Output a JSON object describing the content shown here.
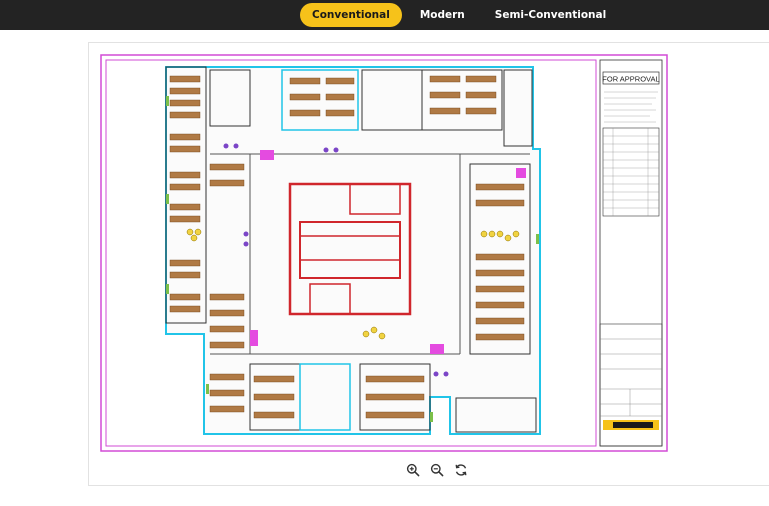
{
  "tabs": [
    {
      "label": "Conventional",
      "active": true
    },
    {
      "label": "Modern",
      "active": false
    },
    {
      "label": "Semi-Conventional",
      "active": false
    }
  ],
  "plan": {
    "stamp_label": "FOR APPROVAL"
  },
  "controls": {
    "zoom_in_icon": "zoom-in-icon",
    "zoom_out_icon": "zoom-out-icon",
    "reset_icon": "refresh-icon"
  },
  "colors": {
    "accent": "#f6c21a",
    "topbar": "#232323",
    "border_magenta": "#d24bd6",
    "wall_red": "#d0262c",
    "outline_cyan": "#21c4e8",
    "furniture_brown": "#8a5a2a"
  }
}
